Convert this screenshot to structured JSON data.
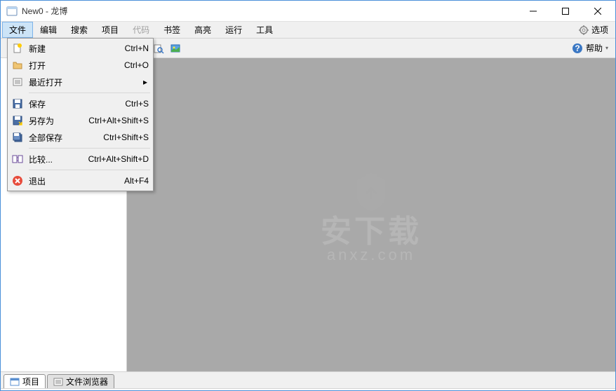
{
  "window": {
    "title": "New0 - 龙博"
  },
  "menubar": {
    "items": [
      {
        "label": "文件",
        "active": true,
        "disabled": false
      },
      {
        "label": "编辑",
        "active": false,
        "disabled": false
      },
      {
        "label": "搜索",
        "active": false,
        "disabled": false
      },
      {
        "label": "项目",
        "active": false,
        "disabled": false
      },
      {
        "label": "代码",
        "active": false,
        "disabled": true
      },
      {
        "label": "书签",
        "active": false,
        "disabled": false
      },
      {
        "label": "高亮",
        "active": false,
        "disabled": false
      },
      {
        "label": "运行",
        "active": false,
        "disabled": false
      },
      {
        "label": "工具",
        "active": false,
        "disabled": false
      }
    ],
    "options_label": "选项"
  },
  "toolbar": {
    "search_placeholder": "",
    "help_label": "帮助"
  },
  "file_menu": {
    "items": [
      {
        "icon": "new-file-icon",
        "label": "新建",
        "shortcut": "Ctrl+N",
        "submenu": false
      },
      {
        "icon": "open-folder-icon",
        "label": "打开",
        "shortcut": "Ctrl+O",
        "submenu": false
      },
      {
        "icon": "recent-icon",
        "label": "最近打开",
        "shortcut": "",
        "submenu": true
      },
      {
        "sep": true
      },
      {
        "icon": "save-icon",
        "label": "保存",
        "shortcut": "Ctrl+S",
        "submenu": false
      },
      {
        "icon": "save-as-icon",
        "label": "另存为",
        "shortcut": "Ctrl+Alt+Shift+S",
        "submenu": false
      },
      {
        "icon": "save-all-icon",
        "label": "全部保存",
        "shortcut": "Ctrl+Shift+S",
        "submenu": false
      },
      {
        "sep": true
      },
      {
        "icon": "compare-icon",
        "label": "比较...",
        "shortcut": "Ctrl+Alt+Shift+D",
        "submenu": false
      },
      {
        "sep": true
      },
      {
        "icon": "exit-icon",
        "label": "退出",
        "shortcut": "Alt+F4",
        "submenu": false
      }
    ]
  },
  "bottom_tabs": {
    "tabs": [
      {
        "label": "项目",
        "active": true,
        "icon": "project-tab-icon"
      },
      {
        "label": "文件浏览器",
        "active": false,
        "icon": "file-browser-tab-icon"
      }
    ]
  },
  "watermark": {
    "big": "安下载",
    "small": "anxz.com"
  }
}
